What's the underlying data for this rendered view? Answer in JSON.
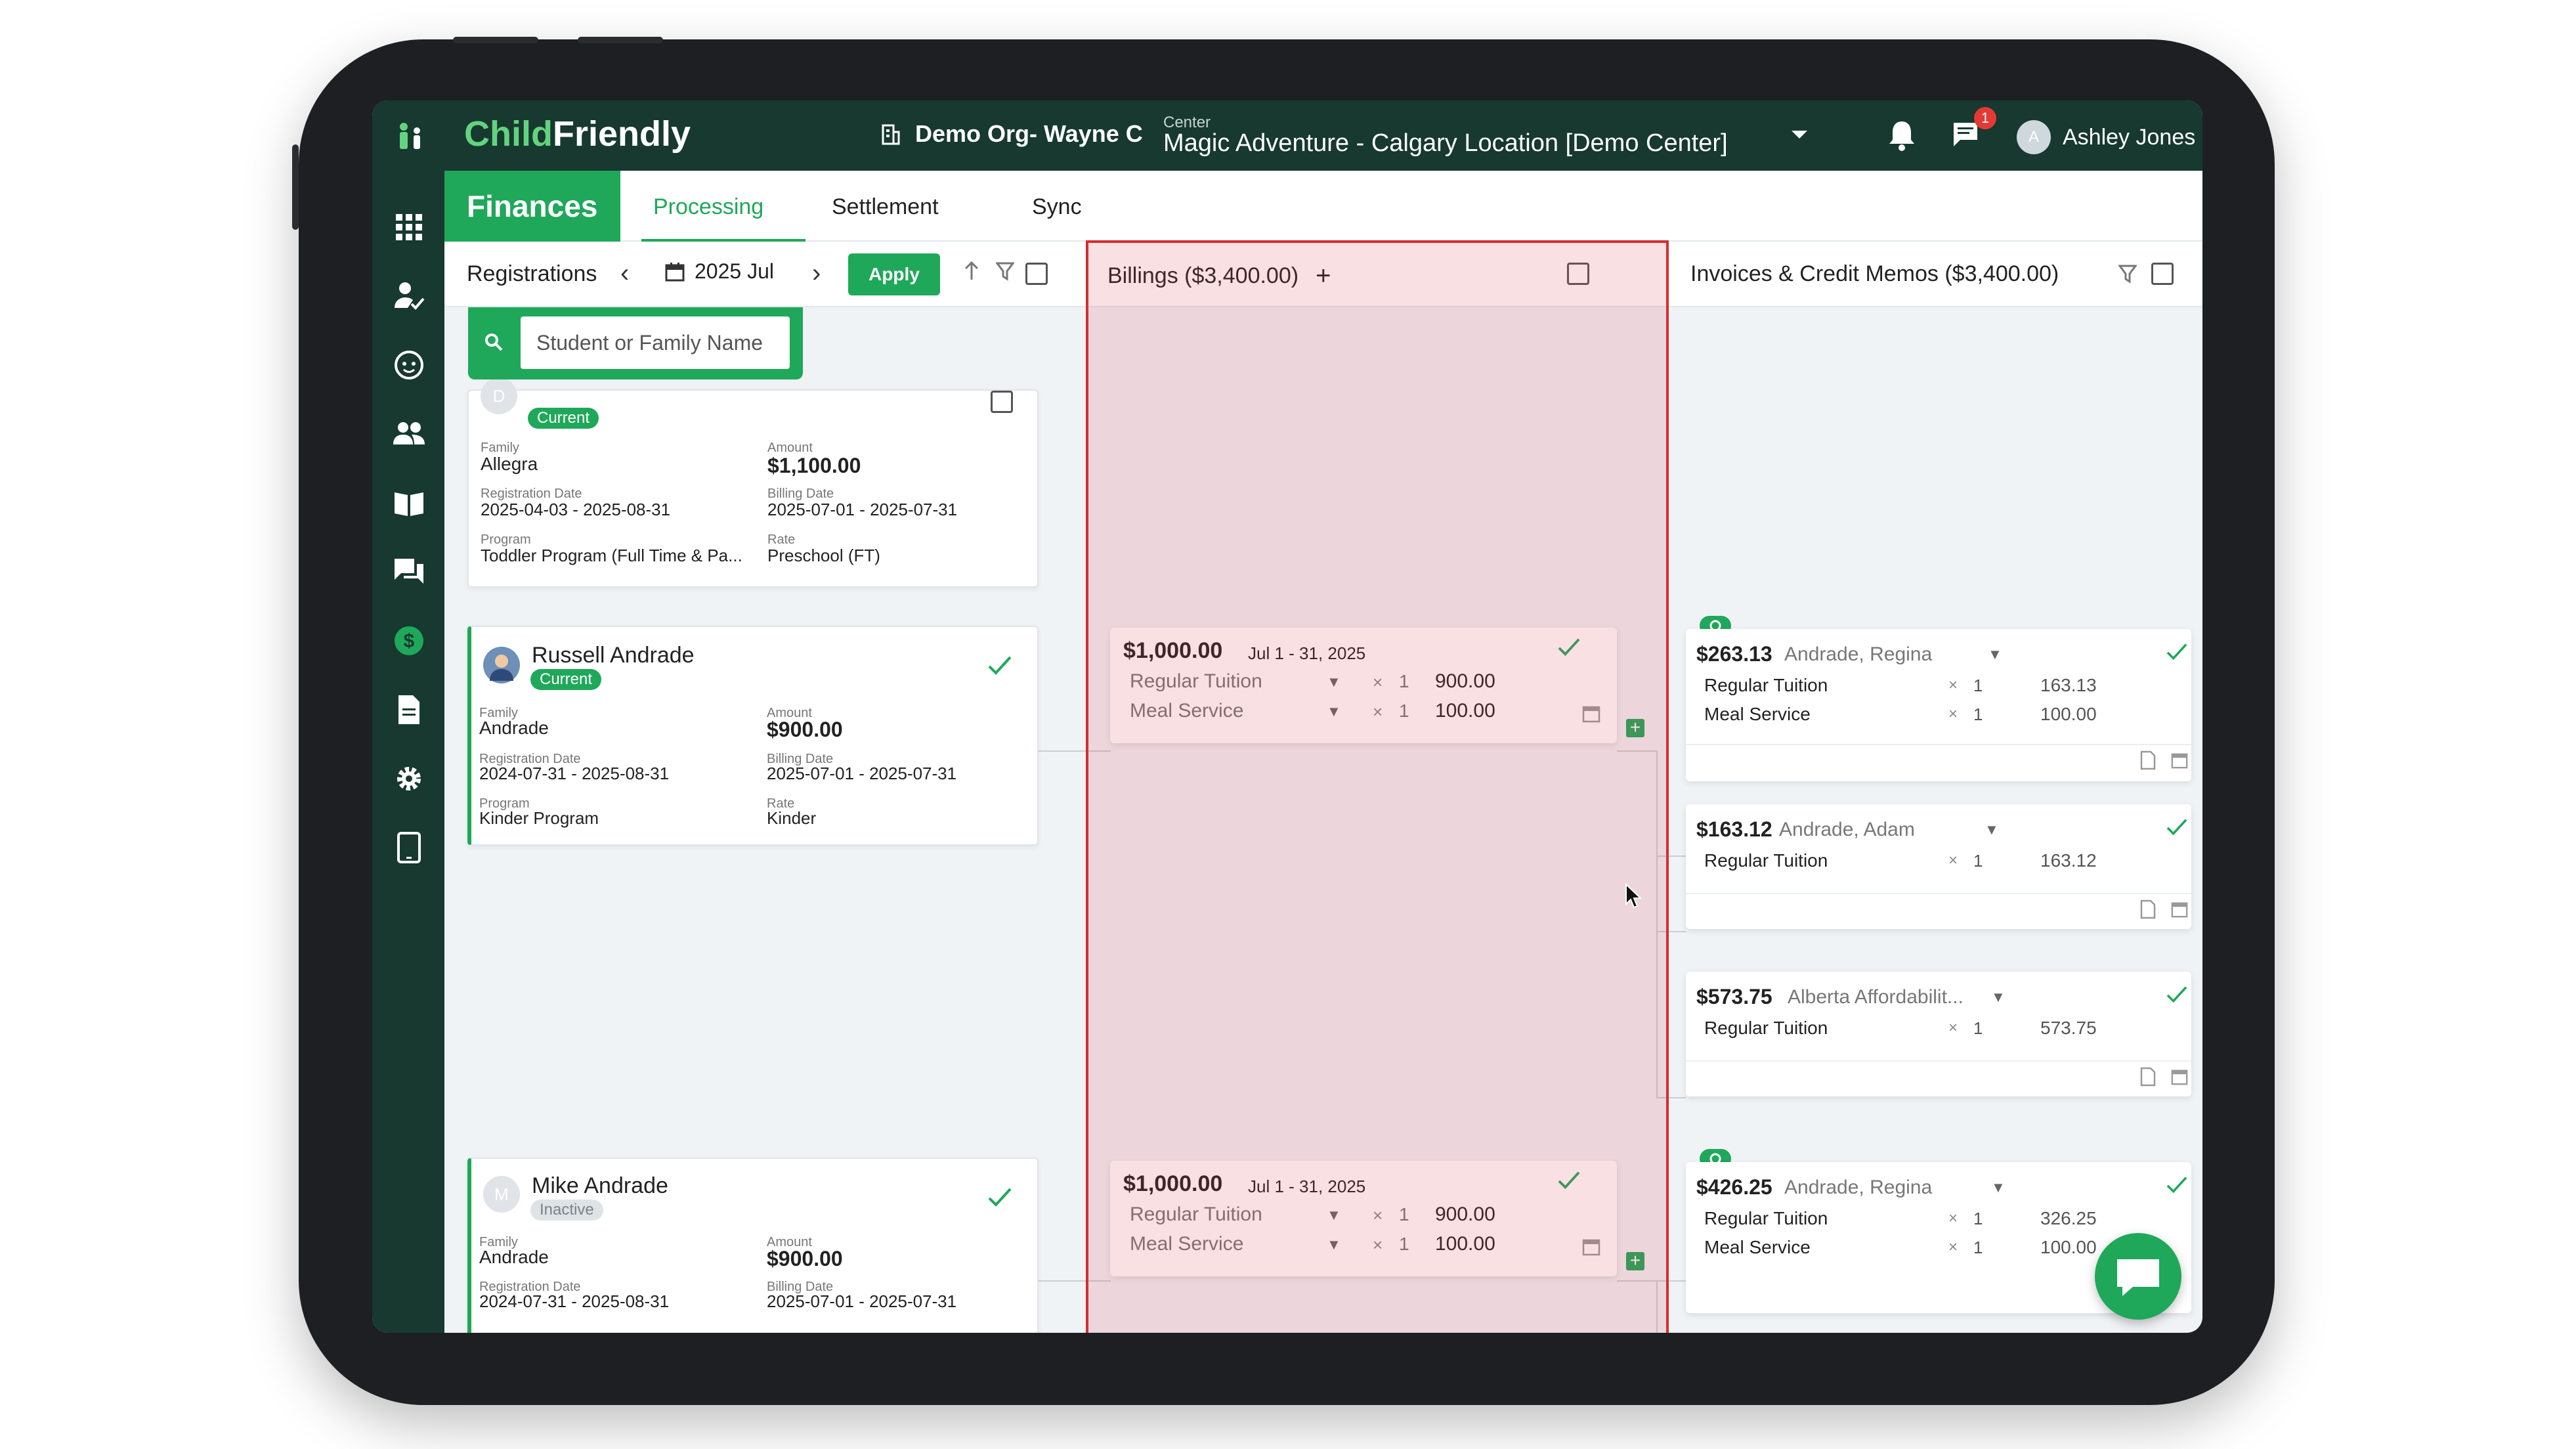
{
  "topbar": {
    "brand_a": "Child",
    "brand_b": "Friendly",
    "org_name": "Demo Org- Wayne C",
    "center_label": "Center",
    "center_name": "Magic Adventure - Calgary Location [Demo Center]",
    "chat_badge": "1",
    "user_initial": "A",
    "user_name": "Ashley Jones"
  },
  "tabs": {
    "finances": "Finances",
    "processing": "Processing",
    "settlement": "Settlement",
    "sync": "Sync"
  },
  "registrations": {
    "title": "Registrations",
    "period": "2025 Jul",
    "apply": "Apply",
    "search_placeholder": "Student or Family Name"
  },
  "billings": {
    "title": "Billings ($3,400.00)",
    "add": "+"
  },
  "invoices": {
    "title": "Invoices & Credit Memos ($3,400.00)"
  },
  "labels": {
    "family": "Family",
    "amount": "Amount",
    "registration_date": "Registration Date",
    "billing_date": "Billing Date",
    "program": "Program",
    "rate": "Rate"
  },
  "reg_cards": [
    {
      "initial": "D",
      "status": "Current",
      "family": "Allegra",
      "amount": "$1,100.00",
      "registration_date": "2025-04-03 - 2025-08-31",
      "billing_date": "2025-07-01 - 2025-07-31",
      "program": "Toddler Program (Full Time & Pa...",
      "rate": "Preschool (FT)"
    },
    {
      "name": "Russell Andrade",
      "status": "Current",
      "family": "Andrade",
      "amount": "$900.00",
      "registration_date": "2024-07-31 - 2025-08-31",
      "billing_date": "2025-07-01 - 2025-07-31",
      "program": "Kinder Program",
      "rate": "Kinder"
    },
    {
      "initial": "M",
      "name": "Mike Andrade",
      "status": "Inactive",
      "family": "Andrade",
      "amount": "$900.00",
      "registration_date": "2024-07-31 - 2025-08-31",
      "billing_date": "2025-07-01 - 2025-07-31"
    }
  ],
  "bill_cards": [
    {
      "amount": "$1,000.00",
      "period": "Jul 1 - 31, 2025",
      "lines": [
        {
          "name": "Regular Tuition",
          "x": "×",
          "qty": "1",
          "price": "900.00"
        },
        {
          "name": "Meal Service",
          "x": "×",
          "qty": "1",
          "price": "100.00"
        }
      ]
    },
    {
      "amount": "$1,000.00",
      "period": "Jul 1 - 31, 2025",
      "lines": [
        {
          "name": "Regular Tuition",
          "x": "×",
          "qty": "1",
          "price": "900.00"
        },
        {
          "name": "Meal Service",
          "x": "×",
          "qty": "1",
          "price": "100.00"
        }
      ]
    }
  ],
  "inv_cards": [
    {
      "amount": "$263.13",
      "who": "Andrade, Regina",
      "lines": [
        {
          "name": "Regular Tuition",
          "x": "×",
          "qty": "1",
          "price": "163.13"
        },
        {
          "name": "Meal Service",
          "x": "×",
          "qty": "1",
          "price": "100.00"
        }
      ]
    },
    {
      "amount": "$163.12",
      "who": "Andrade, Adam",
      "lines": [
        {
          "name": "Regular Tuition",
          "x": "×",
          "qty": "1",
          "price": "163.12"
        }
      ]
    },
    {
      "amount": "$573.75",
      "who": "Alberta Affordabilit...",
      "lines": [
        {
          "name": "Regular Tuition",
          "x": "×",
          "qty": "1",
          "price": "573.75"
        }
      ]
    },
    {
      "amount": "$426.25",
      "who": "Andrade, Regina",
      "lines": [
        {
          "name": "Regular Tuition",
          "x": "×",
          "qty": "1",
          "price": "326.25"
        },
        {
          "name": "Meal Service",
          "x": "×",
          "qty": "1",
          "price": "100.00"
        }
      ]
    }
  ],
  "colors": {
    "brand_green": "#1fa85a",
    "nav_dark": "#17392f",
    "highlight_red": "#d32f2f"
  }
}
